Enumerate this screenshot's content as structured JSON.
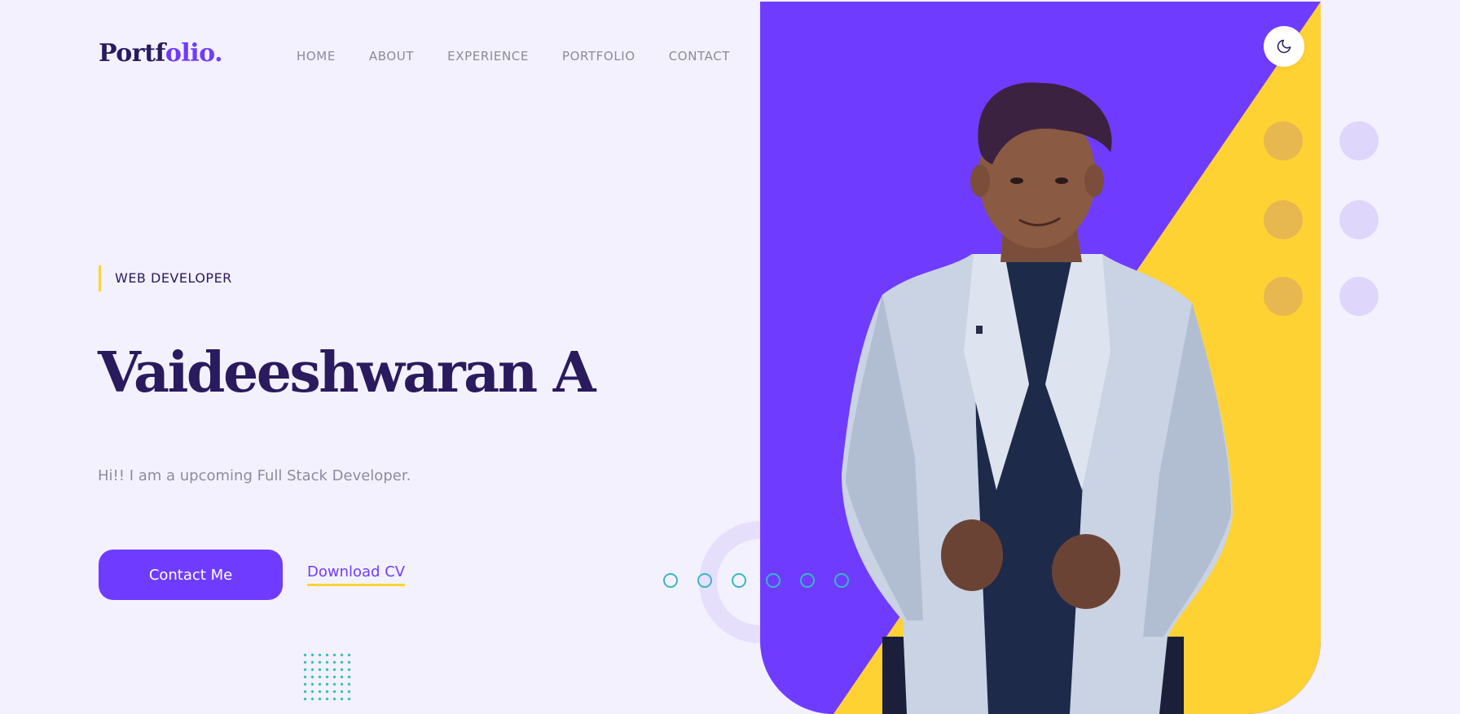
{
  "header": {
    "logo_part1": "Portf",
    "logo_part2": "olio",
    "logo_dot": "."
  },
  "nav": {
    "items": [
      {
        "label": "HOME"
      },
      {
        "label": "ABOUT"
      },
      {
        "label": "EXPERIENCE"
      },
      {
        "label": "PORTFOLIO"
      },
      {
        "label": "CONTACT"
      }
    ]
  },
  "hero": {
    "eyebrow": "WEB DEVELOPER",
    "name": "Vaideeshwaran A",
    "tagline": "Hi!! I am a upcoming Full Stack Developer.",
    "contact_label": "Contact Me",
    "download_label": "Download CV",
    "slider_dot_count": 6,
    "portrait_icon": "person-portrait"
  },
  "theme_toggle": {
    "icon": "moon-icon"
  },
  "colors": {
    "background": "#f4f1fe",
    "primary": "#6f3cff",
    "accent_yellow": "#ffd233",
    "heading": "#2a1a5e",
    "muted": "#8c8ca0",
    "teal": "#36b8c2"
  }
}
